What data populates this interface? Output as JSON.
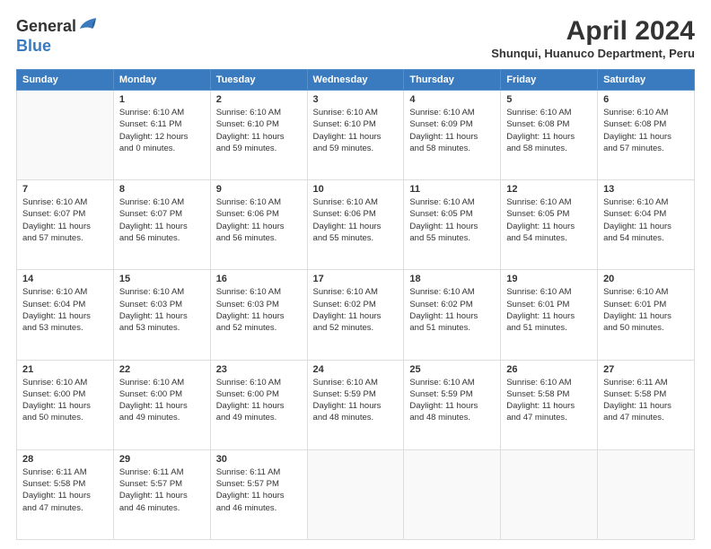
{
  "header": {
    "logo_general": "General",
    "logo_blue": "Blue",
    "title": "April 2024",
    "subtitle": "Shunqui, Huanuco Department, Peru"
  },
  "days_of_week": [
    "Sunday",
    "Monday",
    "Tuesday",
    "Wednesday",
    "Thursday",
    "Friday",
    "Saturday"
  ],
  "weeks": [
    [
      {
        "day": "",
        "info": ""
      },
      {
        "day": "1",
        "info": "Sunrise: 6:10 AM\nSunset: 6:11 PM\nDaylight: 12 hours\nand 0 minutes."
      },
      {
        "day": "2",
        "info": "Sunrise: 6:10 AM\nSunset: 6:10 PM\nDaylight: 11 hours\nand 59 minutes."
      },
      {
        "day": "3",
        "info": "Sunrise: 6:10 AM\nSunset: 6:10 PM\nDaylight: 11 hours\nand 59 minutes."
      },
      {
        "day": "4",
        "info": "Sunrise: 6:10 AM\nSunset: 6:09 PM\nDaylight: 11 hours\nand 58 minutes."
      },
      {
        "day": "5",
        "info": "Sunrise: 6:10 AM\nSunset: 6:08 PM\nDaylight: 11 hours\nand 58 minutes."
      },
      {
        "day": "6",
        "info": "Sunrise: 6:10 AM\nSunset: 6:08 PM\nDaylight: 11 hours\nand 57 minutes."
      }
    ],
    [
      {
        "day": "7",
        "info": "Sunrise: 6:10 AM\nSunset: 6:07 PM\nDaylight: 11 hours\nand 57 minutes."
      },
      {
        "day": "8",
        "info": "Sunrise: 6:10 AM\nSunset: 6:07 PM\nDaylight: 11 hours\nand 56 minutes."
      },
      {
        "day": "9",
        "info": "Sunrise: 6:10 AM\nSunset: 6:06 PM\nDaylight: 11 hours\nand 56 minutes."
      },
      {
        "day": "10",
        "info": "Sunrise: 6:10 AM\nSunset: 6:06 PM\nDaylight: 11 hours\nand 55 minutes."
      },
      {
        "day": "11",
        "info": "Sunrise: 6:10 AM\nSunset: 6:05 PM\nDaylight: 11 hours\nand 55 minutes."
      },
      {
        "day": "12",
        "info": "Sunrise: 6:10 AM\nSunset: 6:05 PM\nDaylight: 11 hours\nand 54 minutes."
      },
      {
        "day": "13",
        "info": "Sunrise: 6:10 AM\nSunset: 6:04 PM\nDaylight: 11 hours\nand 54 minutes."
      }
    ],
    [
      {
        "day": "14",
        "info": "Sunrise: 6:10 AM\nSunset: 6:04 PM\nDaylight: 11 hours\nand 53 minutes."
      },
      {
        "day": "15",
        "info": "Sunrise: 6:10 AM\nSunset: 6:03 PM\nDaylight: 11 hours\nand 53 minutes."
      },
      {
        "day": "16",
        "info": "Sunrise: 6:10 AM\nSunset: 6:03 PM\nDaylight: 11 hours\nand 52 minutes."
      },
      {
        "day": "17",
        "info": "Sunrise: 6:10 AM\nSunset: 6:02 PM\nDaylight: 11 hours\nand 52 minutes."
      },
      {
        "day": "18",
        "info": "Sunrise: 6:10 AM\nSunset: 6:02 PM\nDaylight: 11 hours\nand 51 minutes."
      },
      {
        "day": "19",
        "info": "Sunrise: 6:10 AM\nSunset: 6:01 PM\nDaylight: 11 hours\nand 51 minutes."
      },
      {
        "day": "20",
        "info": "Sunrise: 6:10 AM\nSunset: 6:01 PM\nDaylight: 11 hours\nand 50 minutes."
      }
    ],
    [
      {
        "day": "21",
        "info": "Sunrise: 6:10 AM\nSunset: 6:00 PM\nDaylight: 11 hours\nand 50 minutes."
      },
      {
        "day": "22",
        "info": "Sunrise: 6:10 AM\nSunset: 6:00 PM\nDaylight: 11 hours\nand 49 minutes."
      },
      {
        "day": "23",
        "info": "Sunrise: 6:10 AM\nSunset: 6:00 PM\nDaylight: 11 hours\nand 49 minutes."
      },
      {
        "day": "24",
        "info": "Sunrise: 6:10 AM\nSunset: 5:59 PM\nDaylight: 11 hours\nand 48 minutes."
      },
      {
        "day": "25",
        "info": "Sunrise: 6:10 AM\nSunset: 5:59 PM\nDaylight: 11 hours\nand 48 minutes."
      },
      {
        "day": "26",
        "info": "Sunrise: 6:10 AM\nSunset: 5:58 PM\nDaylight: 11 hours\nand 47 minutes."
      },
      {
        "day": "27",
        "info": "Sunrise: 6:11 AM\nSunset: 5:58 PM\nDaylight: 11 hours\nand 47 minutes."
      }
    ],
    [
      {
        "day": "28",
        "info": "Sunrise: 6:11 AM\nSunset: 5:58 PM\nDaylight: 11 hours\nand 47 minutes."
      },
      {
        "day": "29",
        "info": "Sunrise: 6:11 AM\nSunset: 5:57 PM\nDaylight: 11 hours\nand 46 minutes."
      },
      {
        "day": "30",
        "info": "Sunrise: 6:11 AM\nSunset: 5:57 PM\nDaylight: 11 hours\nand 46 minutes."
      },
      {
        "day": "",
        "info": ""
      },
      {
        "day": "",
        "info": ""
      },
      {
        "day": "",
        "info": ""
      },
      {
        "day": "",
        "info": ""
      }
    ]
  ]
}
